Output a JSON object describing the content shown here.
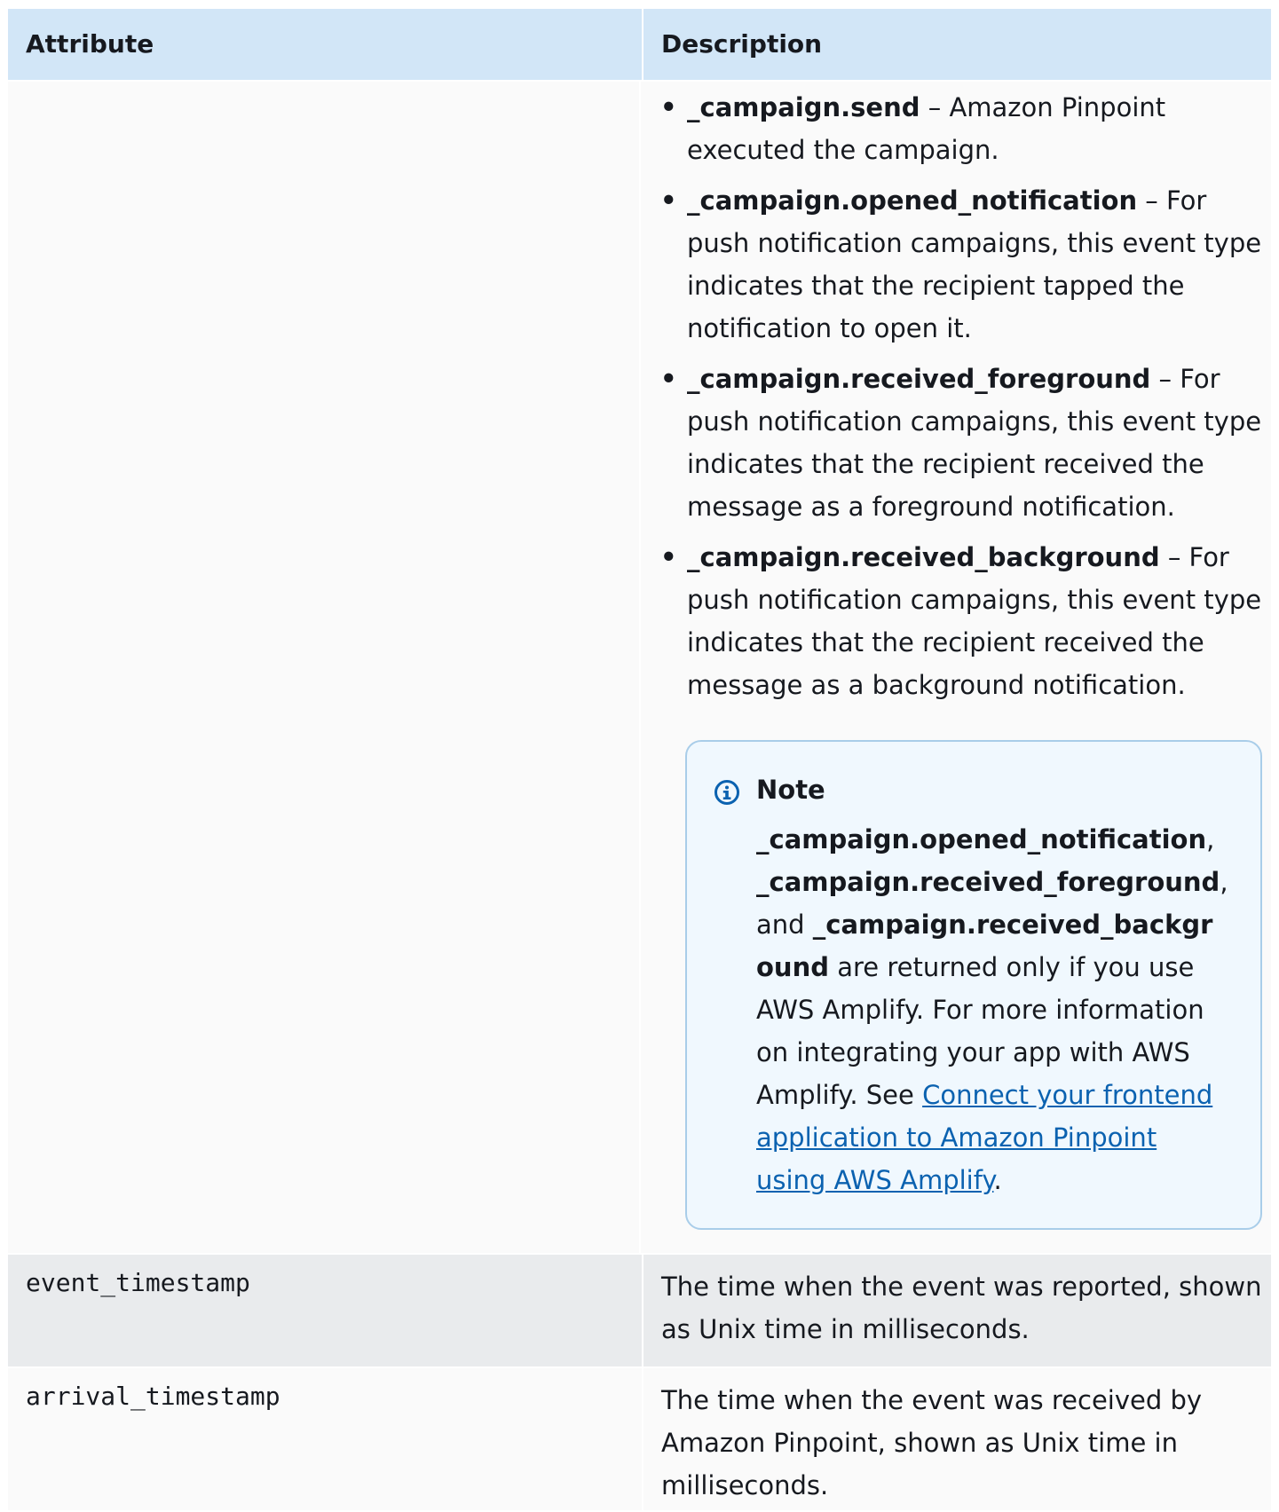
{
  "table": {
    "headers": {
      "attribute": "Attribute",
      "description": "Description"
    },
    "campaign_row": {
      "events": [
        {
          "name": "_campaign.send",
          "sep": " – ",
          "text": "Amazon Pinpoint executed the campaign."
        },
        {
          "name": "_campaign.opened_notification",
          "sep": " – ",
          "text": "For push notification campaigns, this event type indicates that the recipient tapped the notification to open it."
        },
        {
          "name": "_campaign.received_foreground",
          "sep": " – ",
          "text": "For push notification campaigns, this event type indicates that the recipient received the message as a foreground notification."
        },
        {
          "name": "_campaign.received_background",
          "sep": " – ",
          "text": "For push notification campaigns, this event type indicates that the recipient received the message as a background notification."
        }
      ],
      "note": {
        "title": "Note",
        "ev1": "_campaign.opened_notification",
        "comma1": ",",
        "ev2": "_campaign.received_foreground",
        "comma2": ",",
        "and": "and",
        "ev3": "_campaign.received_background",
        "text": "are returned only if you use AWS Amplify. For more information on integrating your app with AWS Amplify. See",
        "link": "Connect your frontend application to Amazon Pinpoint using AWS Amplify",
        "period": "."
      }
    },
    "event_row": {
      "attribute": "event_timestamp",
      "description": "The time when the event was reported, shown as Unix time in milliseconds."
    },
    "arrival_row": {
      "attribute": "arrival_timestamp",
      "description": "The time when the event was received by Amazon Pinpoint, shown as Unix time in milliseconds."
    }
  },
  "colors": {
    "header_bg": "#d2e6f7",
    "note_bg": "#f0f8fe",
    "note_border": "#a9cde9",
    "link": "#0b62b0",
    "info_icon": "#0b62b0"
  }
}
